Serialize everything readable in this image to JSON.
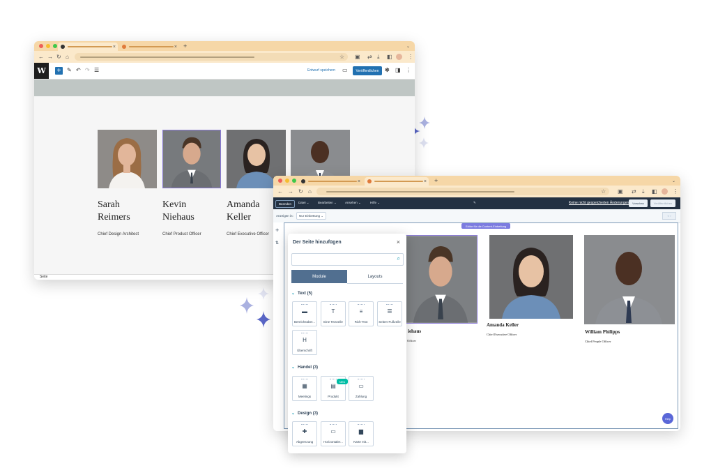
{
  "colors": {
    "tabbar": "#f6d7a7",
    "wp_blue": "#2271b1",
    "hs_navy": "#233142",
    "sparkle_dark": "#5a67c8",
    "sparkle_light": "#c9cde8"
  },
  "wordpress": {
    "save_draft": "Entwurf speichern",
    "publish": "Veröffentlichen",
    "status": "Seite",
    "people": [
      {
        "first": "Sarah",
        "last": "Reimers",
        "role": "Chief Design Architect"
      },
      {
        "first": "Kevin",
        "last": "Niehaus",
        "role": "Chief Product Officer"
      },
      {
        "first": "Amanda",
        "last": "Keller",
        "role": "Chief Executive Officer"
      },
      {
        "first": "",
        "last": "",
        "role": ""
      }
    ]
  },
  "hubspot": {
    "back_button": "Beenden",
    "menu": [
      "Datei",
      "Bearbeiten",
      "Ansehen",
      "Hilfe"
    ],
    "unsaved": "Keine nicht gespeicherten Änderungen",
    "preview": "Vorschau",
    "publish": "Veröffentlichen",
    "show_in_label": "Anzeigen in:",
    "show_in_value": "Nur Einbettung",
    "editor_label": "Editor für die Content-Einbettung",
    "help": "Help",
    "people": [
      {
        "name": "Kevin Niehaus",
        "name_visible": "iehaus",
        "role_visible": "Officer"
      },
      {
        "name": "Amanda Keller",
        "role": "Chief Executive Officer"
      },
      {
        "name": "William Philipps",
        "role": "Chief People Officer"
      }
    ]
  },
  "panel": {
    "title": "Der Seite hinzufügen",
    "tabs": [
      "Module",
      "Layouts"
    ],
    "sections": [
      {
        "label": "Text (5)",
        "modules": [
          {
            "label": "Bereichsüber...",
            "icon": "heading-icon"
          },
          {
            "label": "Eine Textzeile",
            "icon": "text-icon"
          },
          {
            "label": "Rich-Text",
            "icon": "rich-text-icon"
          },
          {
            "label": "Seiten-Fußzeile",
            "icon": "footer-icon"
          },
          {
            "label": "Überschrift",
            "icon": "h-icon"
          }
        ]
      },
      {
        "label": "Handel (3)",
        "modules": [
          {
            "label": "Meetings",
            "icon": "calendar-icon"
          },
          {
            "label": "Produkt",
            "icon": "product-icon",
            "badge": "NEU"
          },
          {
            "label": "Zahlung",
            "icon": "payment-icon"
          }
        ]
      },
      {
        "label": "Design (3)",
        "modules": [
          {
            "label": "Abgrenzung",
            "icon": "divider-icon"
          },
          {
            "label": "Horizontaler...",
            "icon": "horizontal-icon"
          },
          {
            "label": "Karte mit...",
            "icon": "folder-icon"
          }
        ]
      }
    ]
  }
}
